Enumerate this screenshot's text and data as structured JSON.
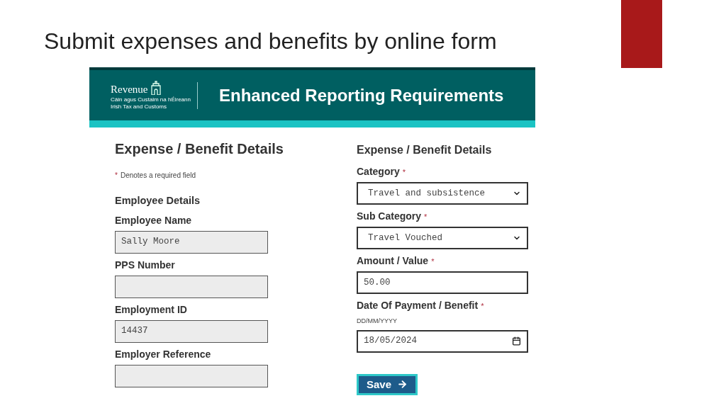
{
  "slide_title": "Submit expenses and benefits by online form",
  "header": {
    "logo": {
      "name": "Revenue",
      "line_1": "Cáin agus Custaim na hÉireann",
      "line_2": "Irish Tax and Customs"
    },
    "title": "Enhanced Reporting Requirements"
  },
  "left": {
    "heading": "Expense / Benefit Details",
    "note": {
      "mark": "*",
      "text": "Denotes a required field"
    },
    "subheading": "Employee Details",
    "fields": [
      {
        "kind": "readonly",
        "label": "Employee Name",
        "value": "Sally Moore"
      },
      {
        "kind": "readonly",
        "label": "PPS Number"
      },
      {
        "kind": "readonly",
        "label": "Employment ID",
        "value": "14437"
      },
      {
        "kind": "readonly",
        "label": "Employer Reference"
      }
    ]
  },
  "right": {
    "heading": "Expense / Benefit Details",
    "fields": [
      {
        "kind": "select",
        "label": "Category",
        "required_mark": "*",
        "value": "Travel and subsistence"
      },
      {
        "kind": "select",
        "label": "Sub Category",
        "required_mark": "*",
        "value": "Travel Vouched"
      },
      {
        "kind": "text",
        "label": "Amount / Value",
        "required_mark": "*",
        "value": "50.00"
      },
      {
        "kind": "date",
        "label": "Date Of Payment / Benefit",
        "required_mark": "*",
        "hint": "DD/MM/YYYY",
        "value": "18/05/2024"
      }
    ],
    "button": "Save"
  }
}
